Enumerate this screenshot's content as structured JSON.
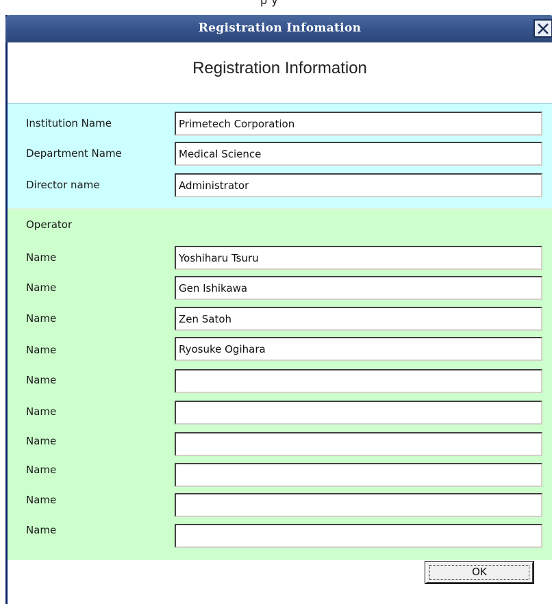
{
  "window": {
    "title": "Registration Infomation",
    "heading": "Registration Information"
  },
  "institution": {
    "institution_label": "Institution Name",
    "institution_value": "Primetech Corporation",
    "department_label": "Department Name",
    "department_value": "Medical Science",
    "director_label": "Director name",
    "director_value": "Administrator"
  },
  "operator": {
    "section_label": "Operator",
    "rows": [
      {
        "label": "Name",
        "value": "Yoshiharu Tsuru"
      },
      {
        "label": "Name",
        "value": "Gen Ishikawa"
      },
      {
        "label": "Name",
        "value": "Zen Satoh"
      },
      {
        "label": "Name",
        "value": "Ryosuke Ogihara"
      },
      {
        "label": "Name",
        "value": ""
      },
      {
        "label": "Name",
        "value": ""
      },
      {
        "label": "Name",
        "value": ""
      },
      {
        "label": "Name",
        "value": ""
      },
      {
        "label": "Name",
        "value": ""
      },
      {
        "label": "Name",
        "value": ""
      }
    ]
  },
  "buttons": {
    "ok_label": "OK"
  },
  "colors": {
    "titlebar": "#35528a",
    "institution_bg": "#ccffff",
    "operator_bg": "#ccffcc"
  },
  "icons": {
    "close": "close-icon"
  }
}
